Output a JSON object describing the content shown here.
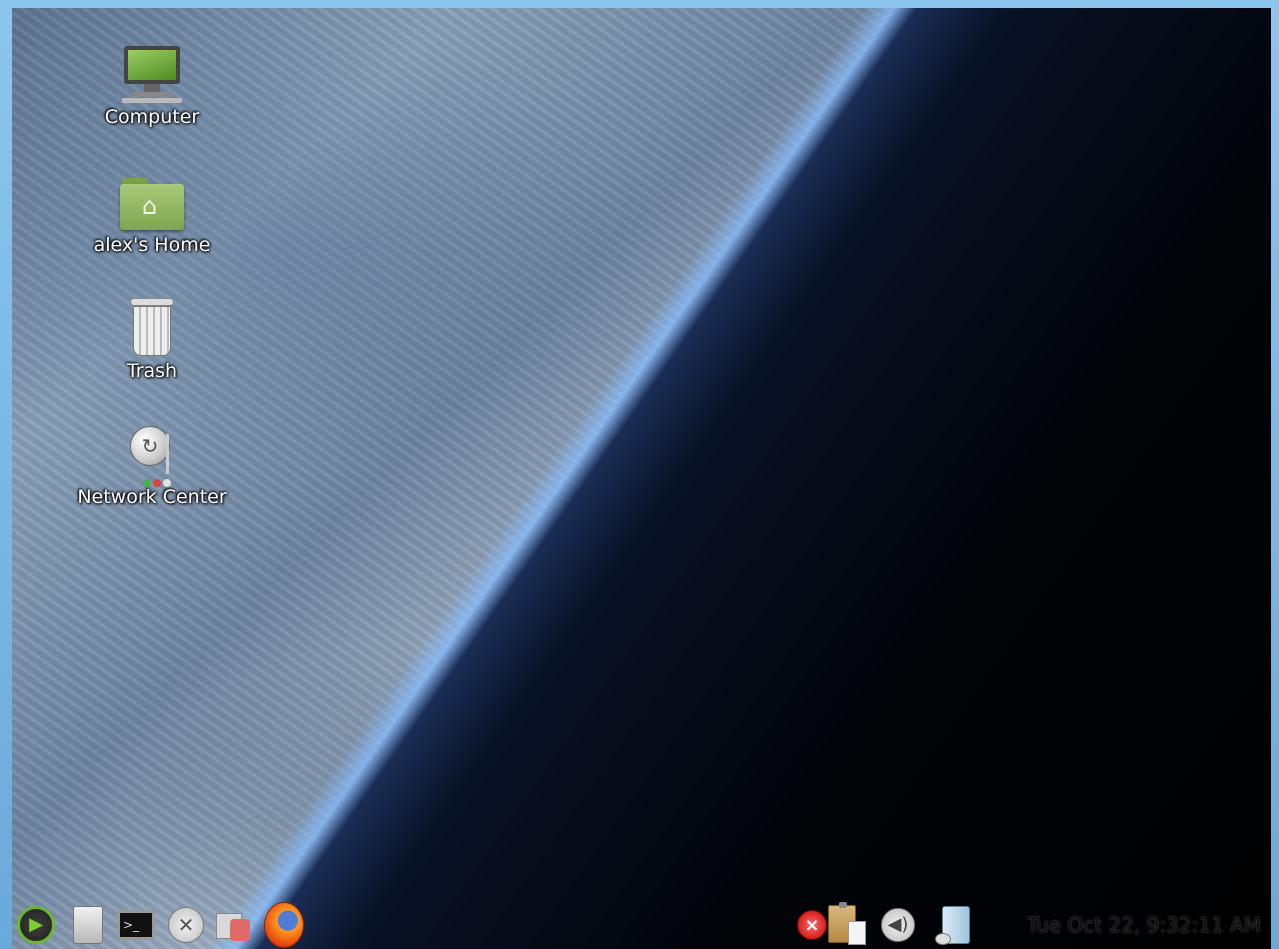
{
  "desktop": {
    "icons": [
      {
        "label": "Computer",
        "icon": "computer-icon"
      },
      {
        "label": "alex's Home",
        "icon": "home-folder-icon"
      },
      {
        "label": "Trash",
        "icon": "trash-icon"
      },
      {
        "label": "Network Center",
        "icon": "network-center-icon"
      }
    ]
  },
  "taskbar": {
    "launchers": [
      {
        "name": "menu-button",
        "icon": "start-menu-icon"
      },
      {
        "name": "files-button",
        "icon": "file-manager-icon"
      },
      {
        "name": "terminal-button",
        "icon": "terminal-icon"
      },
      {
        "name": "settings-button",
        "icon": "tools-icon"
      },
      {
        "name": "package-manager-button",
        "icon": "package-icon"
      },
      {
        "name": "firefox-button",
        "icon": "firefox-icon"
      }
    ],
    "tray": [
      {
        "name": "error-tray-icon",
        "icon": "error-icon"
      },
      {
        "name": "clipboard-tray-icon",
        "icon": "clipboard-icon"
      },
      {
        "name": "volume-tray-icon",
        "icon": "speaker-icon"
      },
      {
        "name": "battery-tray-icon",
        "icon": "battery-icon"
      }
    ],
    "clock": "Tue Oct 22,  9:32:11 AM"
  }
}
